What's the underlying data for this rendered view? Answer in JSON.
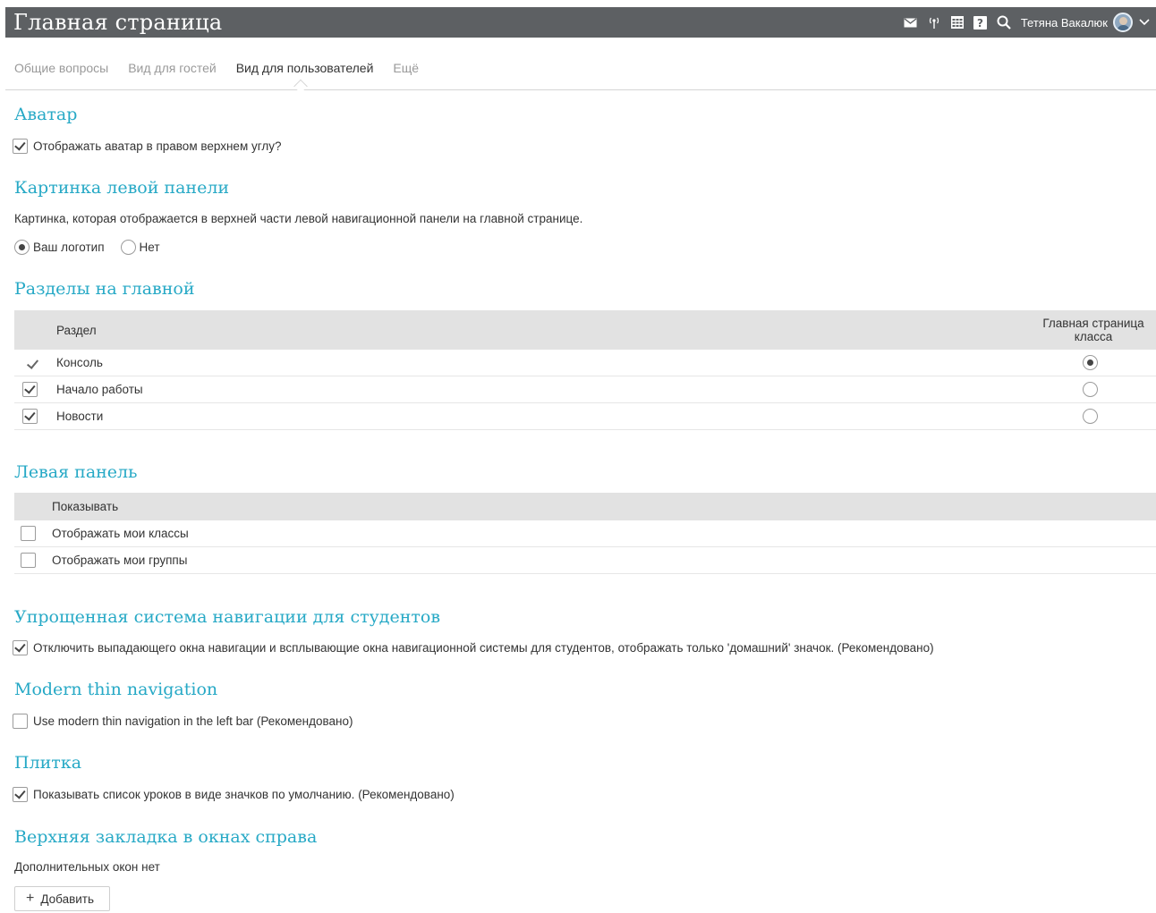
{
  "header": {
    "title": "Главная страница",
    "user_name": "Тетяна Вакалюк",
    "icons": [
      "mail-icon",
      "signal-icon",
      "calendar-icon",
      "help-icon",
      "search-icon",
      "avatar",
      "chevron-down-icon"
    ]
  },
  "tabs": [
    "Общие вопросы",
    "Вид для гостей",
    "Вид для пользователей",
    "Ещё"
  ],
  "active_tab": "Вид для пользователей",
  "avatar_section": {
    "heading": "Аватар",
    "option": "Отображать аватар в правом верхнем углу?",
    "checked": true
  },
  "left_panel_image": {
    "heading": "Картинка левой панели",
    "description": "Картинка, которая отображается в верхней части левой навигационной панели на главной странице.",
    "options": [
      "Ваш логотип",
      "Нет"
    ],
    "selected": "Ваш логотип"
  },
  "sections": {
    "heading": "Разделы на главной",
    "col_section": "Раздел",
    "col_home_line1": "Главная страница",
    "col_home_line2": "класса",
    "rows": [
      {
        "label": "Консоль",
        "checked": true,
        "home": true
      },
      {
        "label": "Начало работы",
        "checked": true,
        "home": false
      },
      {
        "label": "Новости",
        "checked": true,
        "home": false
      }
    ]
  },
  "left_bar": {
    "heading": "Левая панель",
    "col_show": "Показывать",
    "rows": [
      {
        "label": "Отображать мои классы",
        "checked": false
      },
      {
        "label": "Отображать мои группы",
        "checked": false
      }
    ]
  },
  "simple_nav": {
    "heading": "Упрощенная система навигации для студентов",
    "option": "Отключить выпадающего окна навигации и всплывающие окна навигационной системы для студентов, отображать только 'домашний' значок. (Рекомендовано)",
    "checked": true
  },
  "modern_nav": {
    "heading": "Modern thin navigation",
    "option": "Use modern thin navigation in the left bar (Рекомендовано)",
    "checked": false
  },
  "tiles": {
    "heading": "Плитка",
    "option": "Показывать список уроков в виде значков по умолчанию. (Рекомендовано)",
    "checked": true
  },
  "top_tab": {
    "heading": "Верхняя закладка в окнах справа",
    "text": "Дополнительных окон нет",
    "add_button": "Добавить"
  },
  "colors": {
    "accent": "#27a9c6",
    "topbar": "#5d6063",
    "table_header": "#e2e2e2"
  }
}
